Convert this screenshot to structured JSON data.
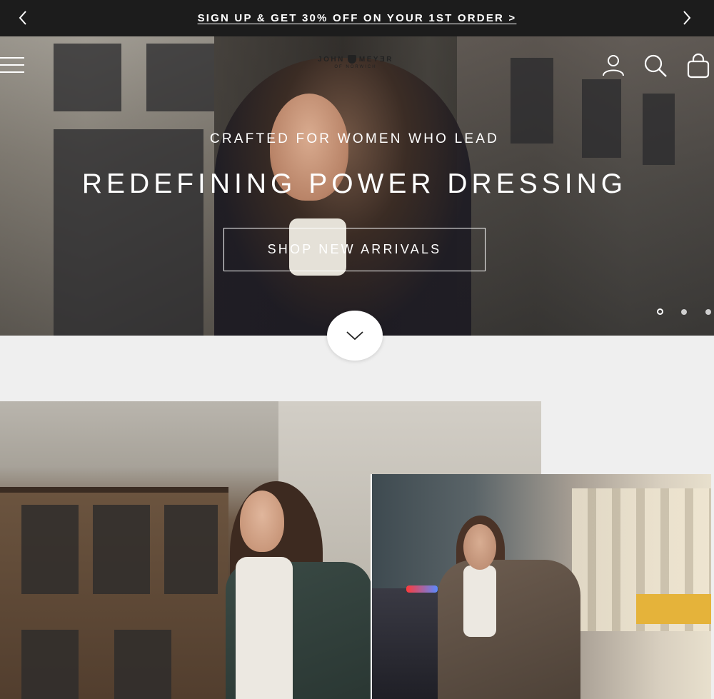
{
  "announcement": {
    "text": "SIGN UP & GET 30% OFF ON YOUR 1ST ORDER >",
    "prev_icon": "chevron-left-icon",
    "next_icon": "chevron-right-icon"
  },
  "header": {
    "logo": {
      "brand": "JOHN",
      "brand_2": "MEYƎR",
      "tagline": "OF NORWICH"
    },
    "icons": [
      "menu-icon",
      "account-icon",
      "search-icon",
      "bag-icon"
    ]
  },
  "hero": {
    "subtitle": "CRAFTED FOR WOMEN WHO LEAD",
    "title": "REDEFINING POWER DRESSING",
    "cta_label": "SHOP NEW ARRIVALS",
    "slides_count": 3,
    "active_slide": 1,
    "scroll_icon": "chevron-down-icon"
  },
  "colors": {
    "announcement_bg": "#1c1c1c",
    "page_bg": "#efefef",
    "text_light": "#ffffff"
  }
}
